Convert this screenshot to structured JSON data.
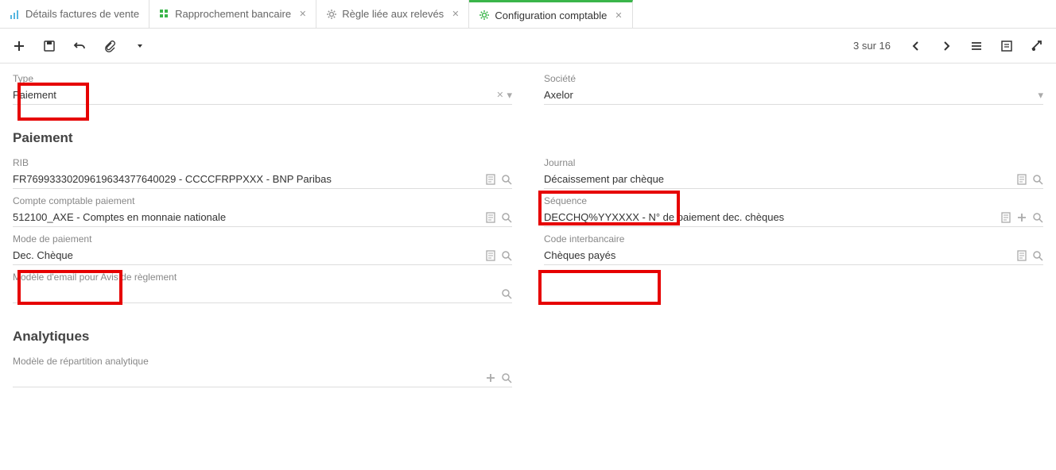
{
  "tabs": [
    {
      "label": "Détails factures de vente",
      "icon": "chart"
    },
    {
      "label": "Rapprochement bancaire",
      "icon": "grid",
      "closable": true
    },
    {
      "label": "Règle liée aux relevés",
      "icon": "gear",
      "closable": true
    },
    {
      "label": "Configuration comptable",
      "icon": "gear",
      "closable": true,
      "active": true
    }
  ],
  "toolbar": {
    "pagination": "3 sur 16"
  },
  "form": {
    "type": {
      "label": "Type",
      "value": "Paiement"
    },
    "societe": {
      "label": "Société",
      "value": "Axelor"
    }
  },
  "sections": {
    "paiement": {
      "title": "Paiement",
      "rib": {
        "label": "RIB",
        "value": "FR76993330209619634377640029 - CCCCFRPPXXX - BNP Paribas"
      },
      "journal": {
        "label": "Journal",
        "value": "Décaissement par chèque"
      },
      "compte": {
        "label": "Compte comptable paiement",
        "value": "512100_AXE - Comptes en monnaie nationale"
      },
      "sequence": {
        "label": "Séquence",
        "value": "DECCHQ%YYXXXX - N° de paiement dec. chèques"
      },
      "mode": {
        "label": "Mode de paiement",
        "value": "Dec. Chèque"
      },
      "code": {
        "label": "Code interbancaire",
        "value": "Chèques payés"
      },
      "modele_email": {
        "label": "Modèle d'email pour Avis de règlement",
        "value": ""
      }
    },
    "analytiques": {
      "title": "Analytiques",
      "modele_repartition": {
        "label": "Modèle de répartition analytique",
        "value": ""
      }
    }
  }
}
